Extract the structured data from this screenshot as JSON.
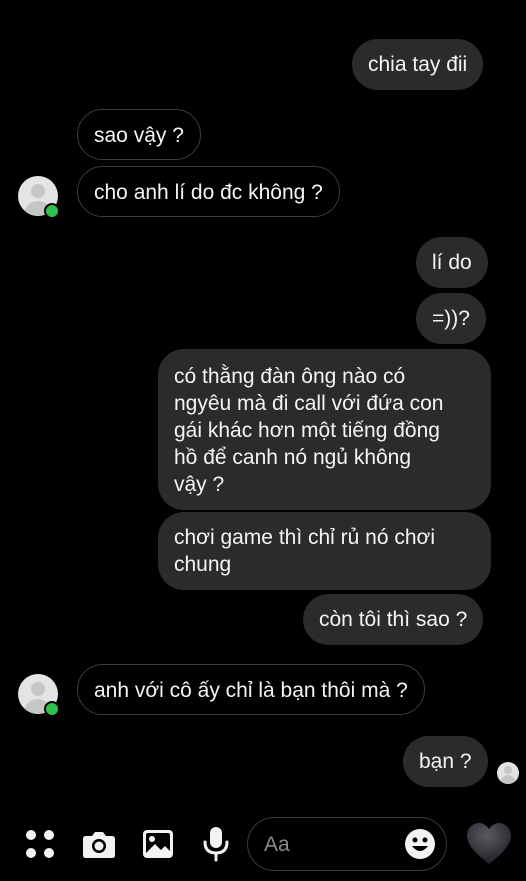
{
  "messages": {
    "m1": "chia tay đii",
    "m2": "sao vậy ?",
    "m3": "cho anh lí do đc không ?",
    "m4": "lí do",
    "m5": "=))?",
    "m6_line1": "có thằng đàn ông nào có",
    "m6_line2": "ngyêu mà đi call với đứa con",
    "m6_line3": "gái khác hơn một tiếng đồng",
    "m6_line4": "hồ để canh nó ngủ không",
    "m6_line5": "vậy ?",
    "m7_line1": "chơi game thì chỉ rủ nó chơi",
    "m7_line2": "chung",
    "m8": "còn tôi thì sao ?",
    "m9": "anh với cô ấy chỉ là bạn thôi mà ?",
    "m10": "bạn ?"
  },
  "composer": {
    "placeholder": "Aa",
    "icons": [
      "apps-icon",
      "camera-icon",
      "gallery-icon",
      "microphone-icon",
      "emoji-icon",
      "heart-icon"
    ]
  },
  "colors": {
    "background": "#000000",
    "sent_bubble": "#2b2b2b",
    "received_border": "#3c3c3c",
    "online": "#31c24d"
  }
}
